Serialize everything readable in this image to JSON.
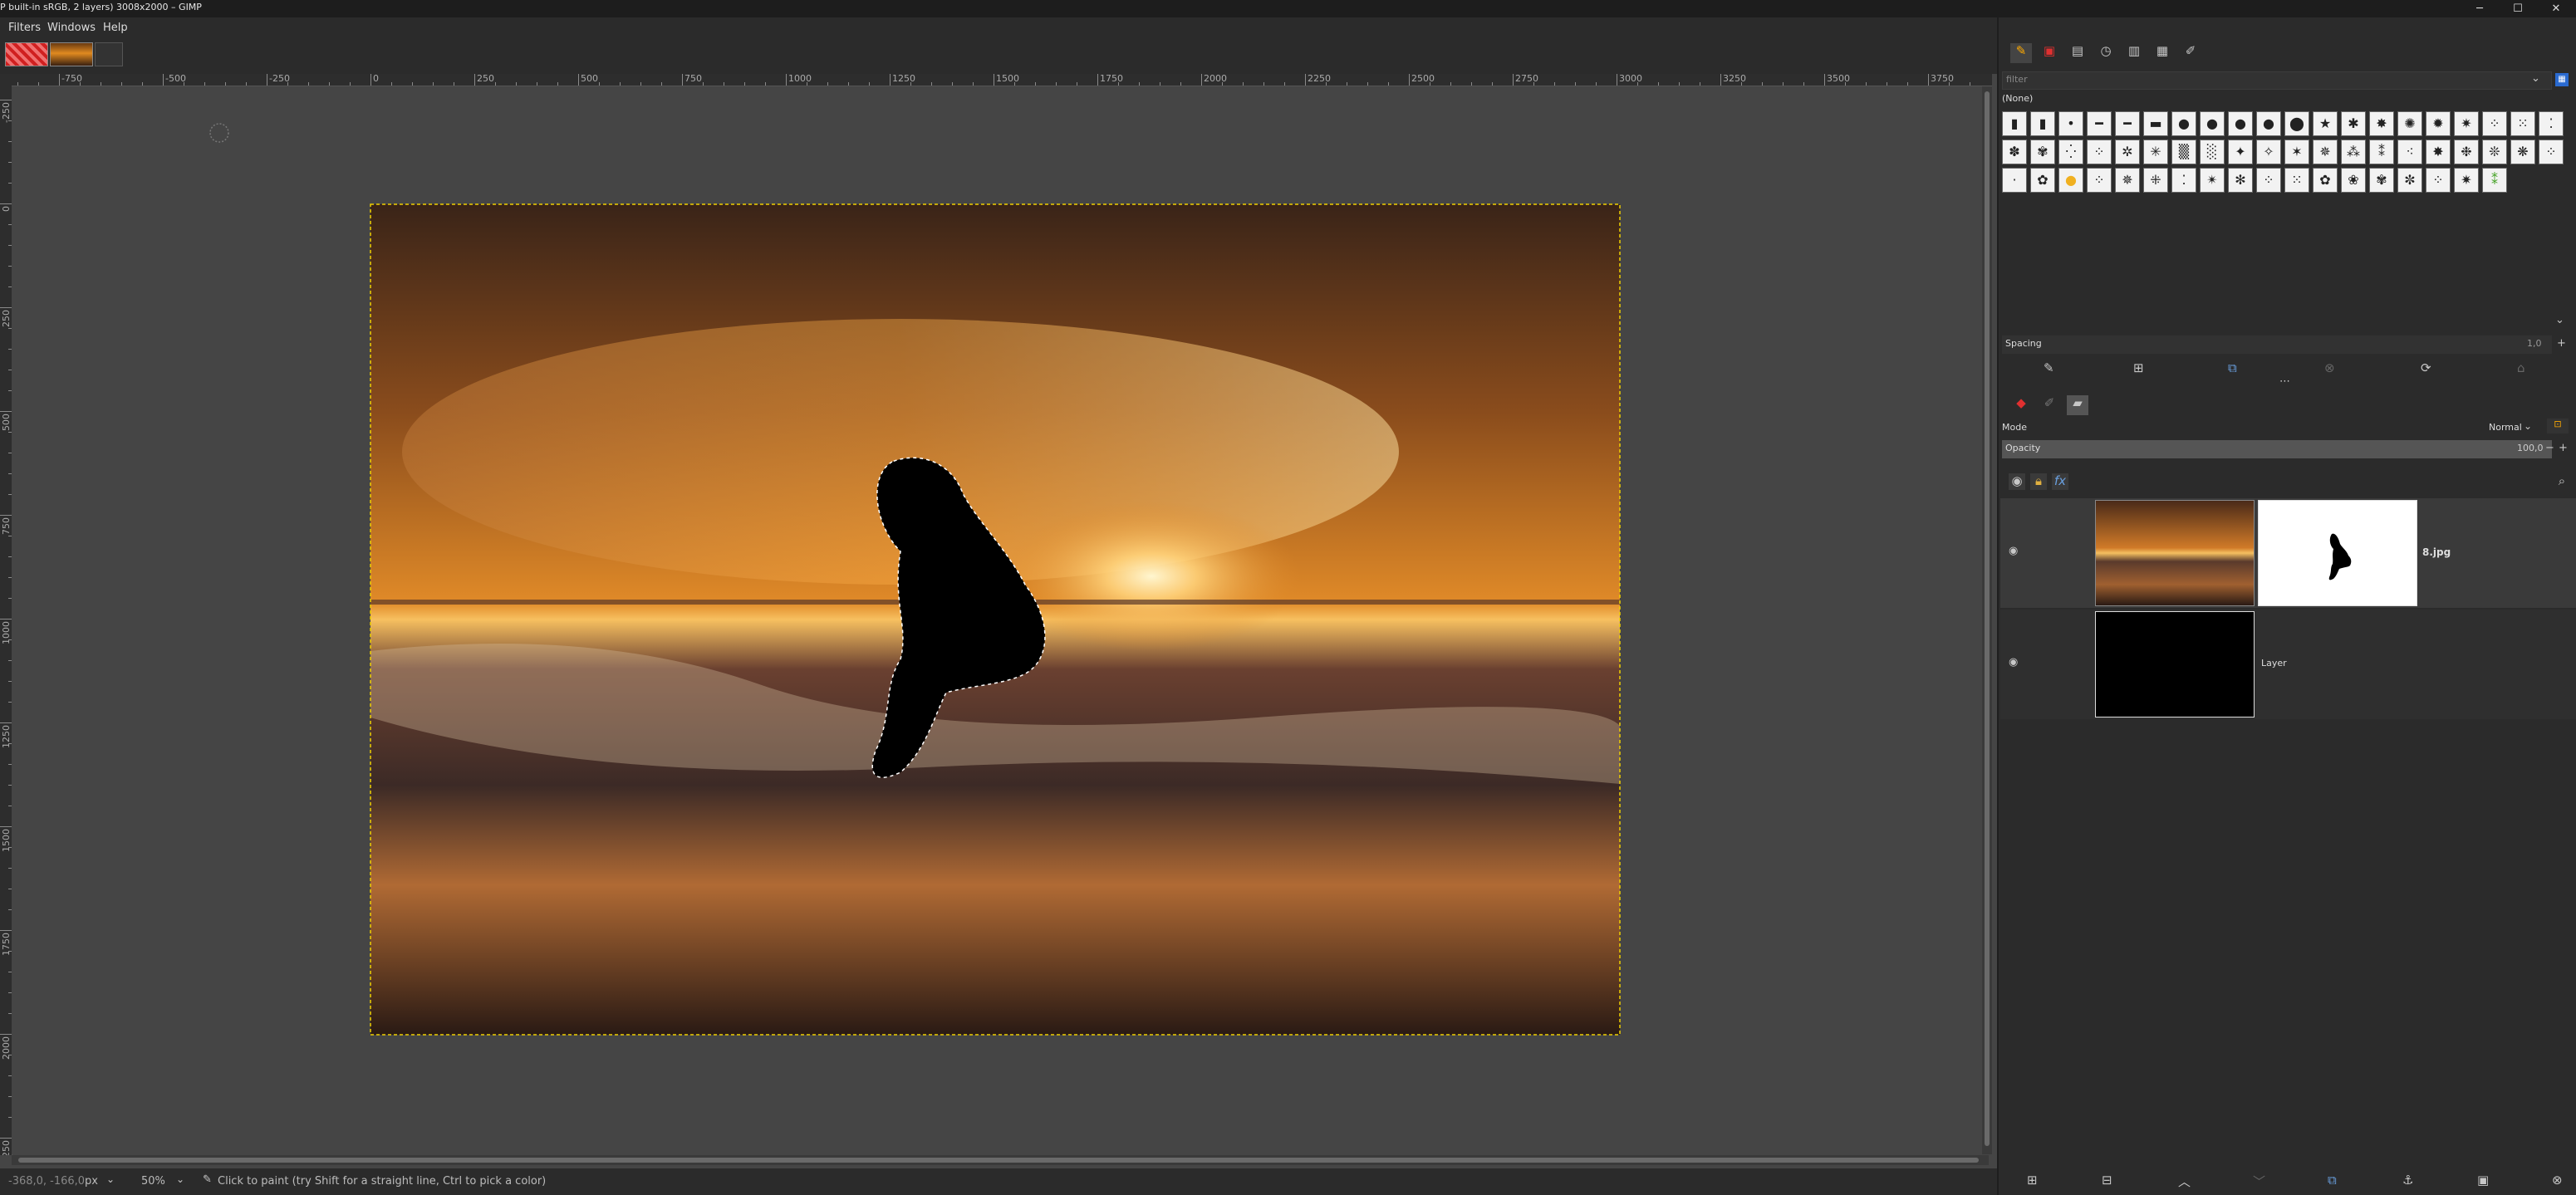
{
  "window": {
    "title": "P built-in sRGB, 2 layers) 3008x2000 – GIMP",
    "controls": {
      "minimize": "─",
      "maximize": "☐",
      "close": "✕"
    }
  },
  "menubar": {
    "items": [
      "Filters",
      "Windows",
      "Help"
    ]
  },
  "image_tabs": [
    {
      "name": "mask-thumb"
    },
    {
      "name": "sunset-thumb"
    }
  ],
  "ruler": {
    "h_labels": [
      "-750",
      "-500",
      "-250",
      "0",
      "250",
      "500",
      "750",
      "1000",
      "1250",
      "1500",
      "1750",
      "2000",
      "2250",
      "2500",
      "2750",
      "3000",
      "3250",
      "3500",
      "3750"
    ],
    "v_labels": [
      "-250",
      "0",
      "250",
      "500",
      "750",
      "1000",
      "1250",
      "1500",
      "1750",
      "2000",
      "2250"
    ]
  },
  "statusbar": {
    "coords": "-368,0, -166,0",
    "unit": "px",
    "zoom": "50%",
    "message": "Click to paint (try Shift for a straight line, Ctrl to pick a color)"
  },
  "brushes": {
    "filter_placeholder": "filter",
    "selected": "(None)",
    "spacing_label": "Spacing",
    "spacing_value": "1,0"
  },
  "layers": {
    "mode_label": "Mode",
    "mode_value": "Normal",
    "opacity_label": "Opacity",
    "opacity_value": "100,0",
    "items": [
      {
        "name": "8.jpg",
        "visible": true,
        "has_mask": true
      },
      {
        "name": "Layer",
        "visible": true,
        "has_mask": false
      }
    ]
  },
  "colors": {
    "selection_outline": "#f0d000",
    "panel_bg": "#2b2b2b",
    "canvas_bg": "#454545"
  }
}
